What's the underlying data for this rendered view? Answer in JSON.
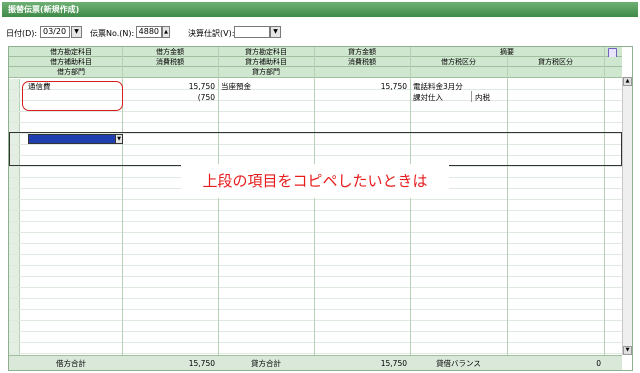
{
  "window": {
    "title": "振替伝票(新規作成)"
  },
  "toolbar": {
    "date_label": "日付(D):",
    "date_value": "03/20",
    "slip_no_label": "伝票No.(N):",
    "slip_no_value": "4880",
    "settlement_label": "決算仕訳(V):",
    "settlement_value": ""
  },
  "header": {
    "row1": [
      "借方勘定科目",
      "借方金額",
      "貸方勘定科目",
      "貸方金額",
      "摘要"
    ],
    "row2": [
      "借方補助科目",
      "消費税額",
      "貸方補助科目",
      "消費税額",
      "借方税区分",
      "貸方税区分"
    ],
    "row3": [
      "借方部門",
      "",
      "貸方部門"
    ]
  },
  "entry": {
    "debit_account": "通信費",
    "debit_amount": "15,750",
    "debit_tax": "(750",
    "credit_account": "当座預金",
    "credit_amount": "15,750",
    "description": "電話料金3月分",
    "debit_tax_category": "課対仕入",
    "debit_tax_type": "内税"
  },
  "footer": {
    "debit_total_label": "借方合計",
    "debit_total": "15,750",
    "credit_total_label": "貸方合計",
    "credit_total": "15,750",
    "balance_label": "貸借バランス",
    "balance": "0"
  },
  "annotation": {
    "text": "上段の項目をコピペしたいときは"
  },
  "colors": {
    "accent": "#3f8a47",
    "header_bg": "#cfe6cf",
    "annotation": "#e81c1c"
  }
}
